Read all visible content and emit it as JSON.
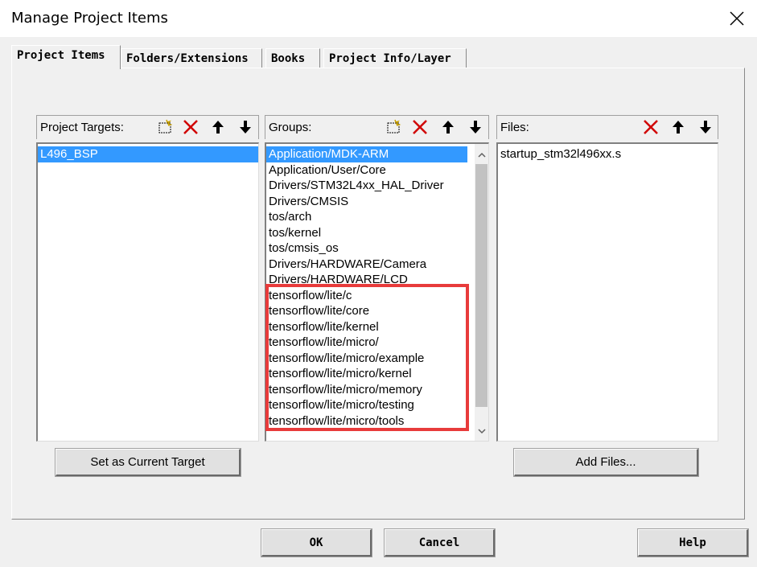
{
  "window": {
    "title": "Manage Project Items",
    "close_icon": "close-icon"
  },
  "tabs": [
    {
      "label": "Project Items",
      "active": true
    },
    {
      "label": "Folders/Extensions",
      "active": false
    },
    {
      "label": "Books",
      "active": false
    },
    {
      "label": "Project Info/Layer",
      "active": false
    }
  ],
  "targets": {
    "header": "Project Targets:",
    "items": [
      "L496_BSP"
    ],
    "selected_index": 0,
    "tools": [
      "new-icon",
      "delete-icon",
      "move-up-icon",
      "move-down-icon"
    ],
    "button": "Set as Current Target"
  },
  "groups": {
    "header": "Groups:",
    "items": [
      "Application/MDK-ARM",
      "Application/User/Core",
      "Drivers/STM32L4xx_HAL_Driver",
      "Drivers/CMSIS",
      "tos/arch",
      "tos/kernel",
      "tos/cmsis_os",
      "Drivers/HARDWARE/Camera",
      "Drivers/HARDWARE/LCD",
      "tensorflow/lite/c",
      "tensorflow/lite/core",
      "tensorflow/lite/kernel",
      "tensorflow/lite/micro/",
      "tensorflow/lite/micro/example",
      "tensorflow/lite/micro/kernel",
      "tensorflow/lite/micro/memory",
      "tensorflow/lite/micro/testing",
      "tensorflow/lite/micro/tools"
    ],
    "selected_index": 0,
    "tools": [
      "new-icon",
      "delete-icon",
      "move-up-icon",
      "move-down-icon"
    ],
    "highlight_color": "#e83b3b"
  },
  "files": {
    "header": "Files:",
    "items": [
      "startup_stm32l496xx.s"
    ],
    "tools": [
      "delete-icon",
      "move-up-icon",
      "move-down-icon"
    ],
    "button": "Add Files..."
  },
  "footer": {
    "ok": "OK",
    "cancel": "Cancel",
    "help": "Help"
  },
  "colors": {
    "selection": "#3399ff",
    "delete_icon": "#d00000"
  }
}
